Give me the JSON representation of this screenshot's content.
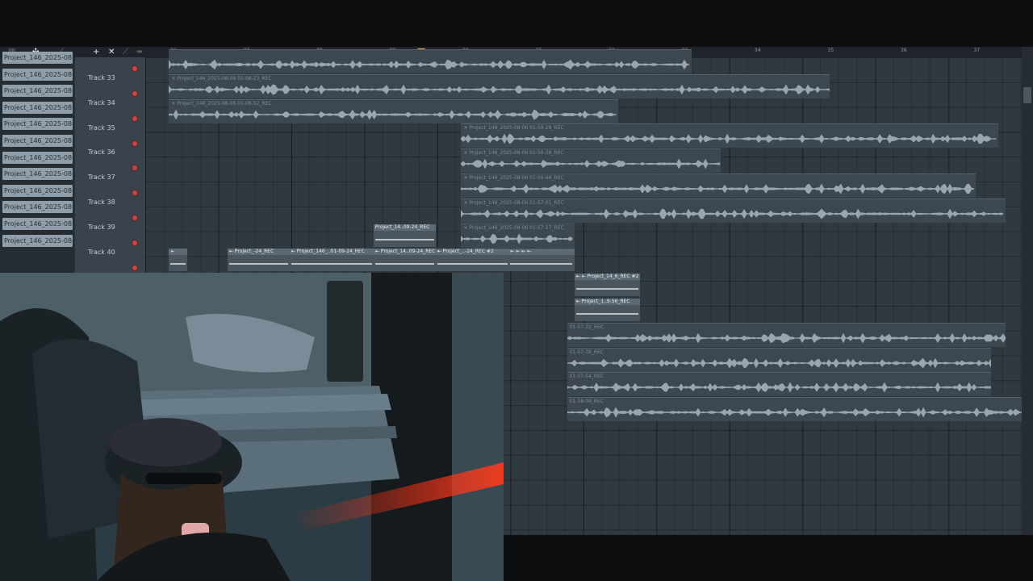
{
  "toolbar": {
    "add_label": "+",
    "close_label": "✕"
  },
  "ruler": {
    "ticks": [
      "26",
      "27",
      "28",
      "29",
      "30",
      "31",
      "32",
      "33",
      "34",
      "35",
      "36",
      "37"
    ],
    "playhead_bar": 29.4
  },
  "pattern_names": [
    "Project_146_2025-08-06...",
    "Project_146_2025-08-06...",
    "Project_146_2025-08-06...",
    "Project_146_2025-08-06...",
    "Project_146_2025-08-06...",
    "Project_146_2025-08-06...",
    "Project_146_2025-08-06...",
    "Project_146_2025-08-06...",
    "Project_146_2025-08-06...",
    "Project_146_2025-08-06...",
    "Project_146_2025-08-06...",
    "Project_146_2025-08-06..."
  ],
  "tracks": [
    "Track 33",
    "Track 34",
    "Track 35",
    "Track 36",
    "Track 37",
    "Track 38",
    "Track 39",
    "Track 40"
  ],
  "clips": [
    {
      "title": "",
      "track": 0,
      "start": 25.95,
      "end": 33.1
    },
    {
      "title": "✕ Project_146_2025-08-06 01-08-23_REC",
      "track": 1,
      "start": 25.95,
      "end": 35.0
    },
    {
      "title": "✕ Project_146_2025-08-06 01-08-52_REC",
      "track": 2,
      "start": 25.95,
      "end": 32.1
    },
    {
      "title": "✕ Project_146_2025-08-06 01-56-28_REC",
      "track": 3,
      "start": 29.95,
      "end": 37.3
    },
    {
      "title": "✕ Project_146_2025-08-06 01-56-36_REC",
      "track": 4,
      "start": 29.95,
      "end": 33.5
    },
    {
      "title": "✕ Project_146_2025-08-06 01-56-46_REC",
      "track": 5,
      "start": 29.95,
      "end": 37.0
    },
    {
      "title": "✕ Project_146_2025-08-06 01-57-01_REC",
      "track": 6,
      "start": 29.95,
      "end": 37.4
    },
    {
      "title": "✕ Project_146_2025-08-06 01-57-17_REC",
      "track": 7,
      "start": 29.95,
      "end": 31.5
    },
    {
      "title": "01-57-22_REC",
      "track": 11,
      "start": 31.4,
      "end": 37.4
    },
    {
      "title": "01-57-38_REC",
      "track": 12,
      "start": 31.4,
      "end": 37.2
    },
    {
      "title": "01-57-54_REC",
      "track": 13,
      "start": 31.4,
      "end": 37.2
    },
    {
      "title": "01-58-09_REC",
      "track": 14,
      "start": 31.4,
      "end": 37.9
    }
  ],
  "small_clips": [
    {
      "title": "Project_14..09-24_REC",
      "track": 7,
      "start": 28.75,
      "end": 29.6
    },
    {
      "title": "⇤",
      "track": 8,
      "start": 25.95,
      "end": 26.2
    },
    {
      "title": "⇤ Project_-24_REC",
      "track": 8,
      "start": 26.75,
      "end": 27.6
    },
    {
      "title": "⇤ Project_146_..01-09-24_REC",
      "track": 8,
      "start": 27.6,
      "end": 28.75
    },
    {
      "title": "⇤ Project_14..09-24_REC",
      "track": 8,
      "start": 28.75,
      "end": 29.6
    },
    {
      "title": "⇤ Project_..-24_REC #2",
      "track": 8,
      "start": 29.6,
      "end": 30.6
    },
    {
      "title": "⇤ ⇤ ⇤ ⇤",
      "track": 8,
      "start": 30.6,
      "end": 31.5
    },
    {
      "title": "⇤ ⇤ Project_14_6_REC #2",
      "track": 9,
      "start": 31.5,
      "end": 32.4
    },
    {
      "title": "⇤ Project_1..9-56_REC",
      "track": 10,
      "start": 31.5,
      "end": 32.4
    }
  ]
}
